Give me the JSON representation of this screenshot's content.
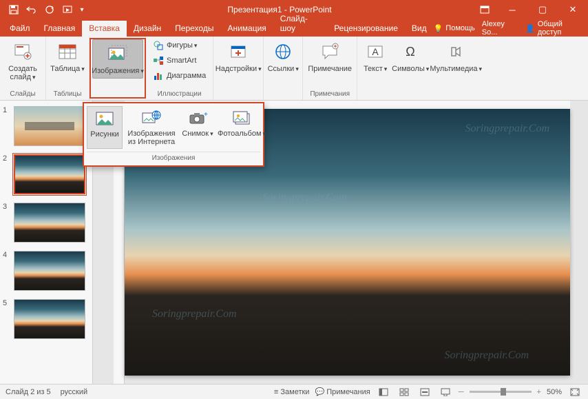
{
  "titlebar": {
    "title": "Презентация1 - PowerPoint"
  },
  "tabs": {
    "file": "Файл",
    "home": "Главная",
    "insert": "Вставка",
    "design": "Дизайн",
    "transitions": "Переходы",
    "animations": "Анимация",
    "slideshow": "Слайд-шоу",
    "review": "Рецензирование",
    "view": "Вид",
    "help": "Помощь",
    "user": "Alexey So...",
    "share": "Общий доступ"
  },
  "ribbon": {
    "new_slide": "Создать слайд",
    "table": "Таблица",
    "images": "Изображения",
    "shapes": "Фигуры",
    "smartart": "SmartArt",
    "chart": "Диаграмма",
    "addins": "Надстройки",
    "links": "Ссылки",
    "comment": "Примечание",
    "text": "Текст",
    "symbols": "Символы",
    "media": "Мультимедиа",
    "g_slides": "Слайды",
    "g_tables": "Таблицы",
    "g_illustrations": "Иллюстрации",
    "g_comments": "Примечания"
  },
  "dropdown": {
    "pictures": "Рисунки",
    "online": "Изображения из Интернета",
    "screenshot": "Снимок",
    "album": "Фотоальбом",
    "footer": "Изображения"
  },
  "thumbs": {
    "n1": "1",
    "n2": "2",
    "n3": "3",
    "n4": "4",
    "n5": "5"
  },
  "status": {
    "slide_info": "Слайд 2 из 5",
    "language": "русский",
    "notes": "Заметки",
    "comments": "Примечания",
    "zoom": "50%",
    "fit": "+"
  }
}
